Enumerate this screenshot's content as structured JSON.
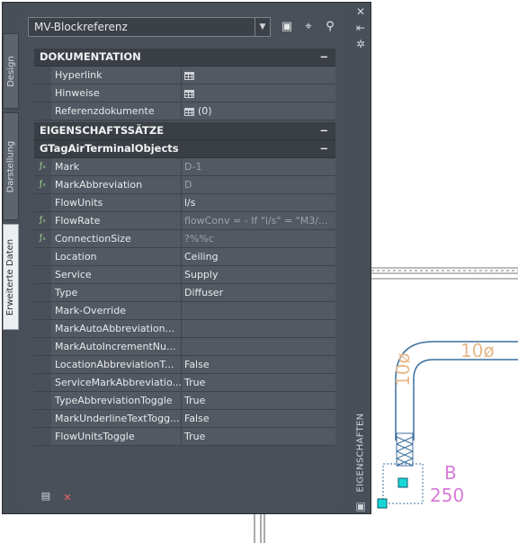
{
  "palette": {
    "title": "EIGENSCHAFTEN",
    "tabs": [
      {
        "label": "Design"
      },
      {
        "label": "Darstellung"
      },
      {
        "label": "Erweiterte Daten"
      }
    ],
    "dropdown": {
      "value": "MV-Blockreferenz"
    },
    "toolbar": {
      "icons": [
        "add-block-icon",
        "select-objects-icon",
        "quick-select-icon"
      ]
    },
    "sections": {
      "dokumentation": {
        "title": "DOKUMENTATION",
        "collapse": "−",
        "rows": [
          {
            "name": "Hyperlink",
            "value": ""
          },
          {
            "name": "Hinweise",
            "value": ""
          },
          {
            "name": "Referenzdokumente",
            "value": "(0)"
          }
        ]
      },
      "eigenschaftssaetze": {
        "title": "EIGENSCHAFTSSÄTZE",
        "collapse": "−"
      },
      "gtag": {
        "title": "GTagAirTerminalObjects",
        "collapse": "−",
        "rows": [
          {
            "name": "Mark",
            "value": "D-1",
            "fx": "f"
          },
          {
            "name": "MarkAbbreviation",
            "value": "D",
            "fx": "f"
          },
          {
            "name": "FlowUnits",
            "value": "l/s",
            "fx": ""
          },
          {
            "name": "FlowRate",
            "value": "flowConv = - If \"l/s\" = \"M3/...",
            "fx": "f"
          },
          {
            "name": "ConnectionSize",
            "value": "?%%c",
            "fx": "f"
          },
          {
            "name": "Location",
            "value": "Ceiling",
            "fx": ""
          },
          {
            "name": "Service",
            "value": "Supply",
            "fx": ""
          },
          {
            "name": "Type",
            "value": "Diffuser",
            "fx": ""
          },
          {
            "name": "Mark-Override",
            "value": "",
            "fx": ""
          },
          {
            "name": "MarkAutoAbbreviation...",
            "value": "",
            "fx": ""
          },
          {
            "name": "MarkAutoIncrementNu...",
            "value": "",
            "fx": ""
          },
          {
            "name": "LocationAbbreviationT...",
            "value": "False",
            "fx": ""
          },
          {
            "name": "ServiceMarkAbbreviatio...",
            "value": "True",
            "fx": ""
          },
          {
            "name": "TypeAbbreviationToggle",
            "value": "True",
            "fx": ""
          },
          {
            "name": "MarkUnderlineTextTogg...",
            "value": "False",
            "fx": ""
          },
          {
            "name": "FlowUnitsToggle",
            "value": "True",
            "fx": ""
          }
        ]
      }
    }
  },
  "cad": {
    "duct_label_h": "10ø",
    "duct_label_v": "10ø",
    "tag_letter": "B",
    "tag_number": "250",
    "colors": {
      "duct": "#3b6f9e",
      "label": "#e6b98a",
      "tag": "#d67bd6",
      "grip": "#19d6d6"
    }
  }
}
